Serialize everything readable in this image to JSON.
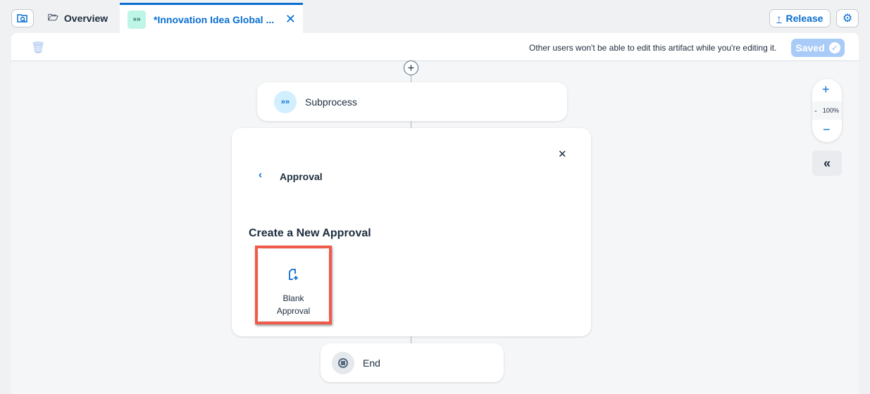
{
  "tabs": {
    "overview": "Overview",
    "active": "*Innovation Idea Global ..."
  },
  "header": {
    "release": "Release"
  },
  "toolbar": {
    "notice": "Other users won't be able to edit this artifact while you're editing it.",
    "saved": "Saved"
  },
  "zoom": {
    "level": "100%"
  },
  "flow": {
    "subprocess": "Subprocess",
    "end": "End"
  },
  "panel": {
    "title": "Approval",
    "heading": "Create a New Approval",
    "option": {
      "line1": "Blank",
      "line2": "Approval"
    }
  },
  "colors": {
    "accent": "#0a6ed1",
    "highlight": "#f05a4a",
    "saved_bg": "#a9cbf7",
    "tab_icon_bg": "#bff5e6"
  }
}
